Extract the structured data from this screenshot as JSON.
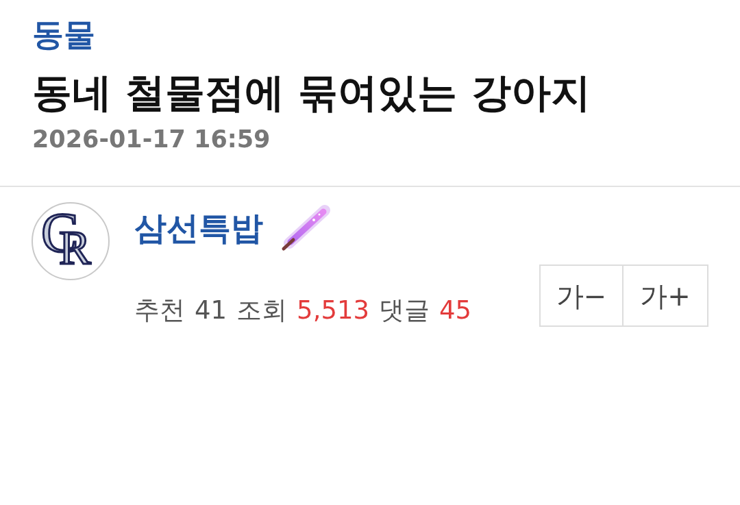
{
  "post": {
    "category": "동물",
    "title": "동네 철물점에 묶여있는 강아지",
    "date": "2026-01-17 16:59"
  },
  "author": {
    "avatar_monogram": "CR",
    "name": "삼선특밥",
    "stats": [
      {
        "label": "추천",
        "value": "41",
        "color": "#555555"
      },
      {
        "label": "조회",
        "value": "5,513",
        "color": "#e33b3b"
      },
      {
        "label": "댓글",
        "value": "45",
        "color": "#e33b3b"
      }
    ]
  },
  "font_size_buttons": [
    "가−",
    "가+"
  ]
}
